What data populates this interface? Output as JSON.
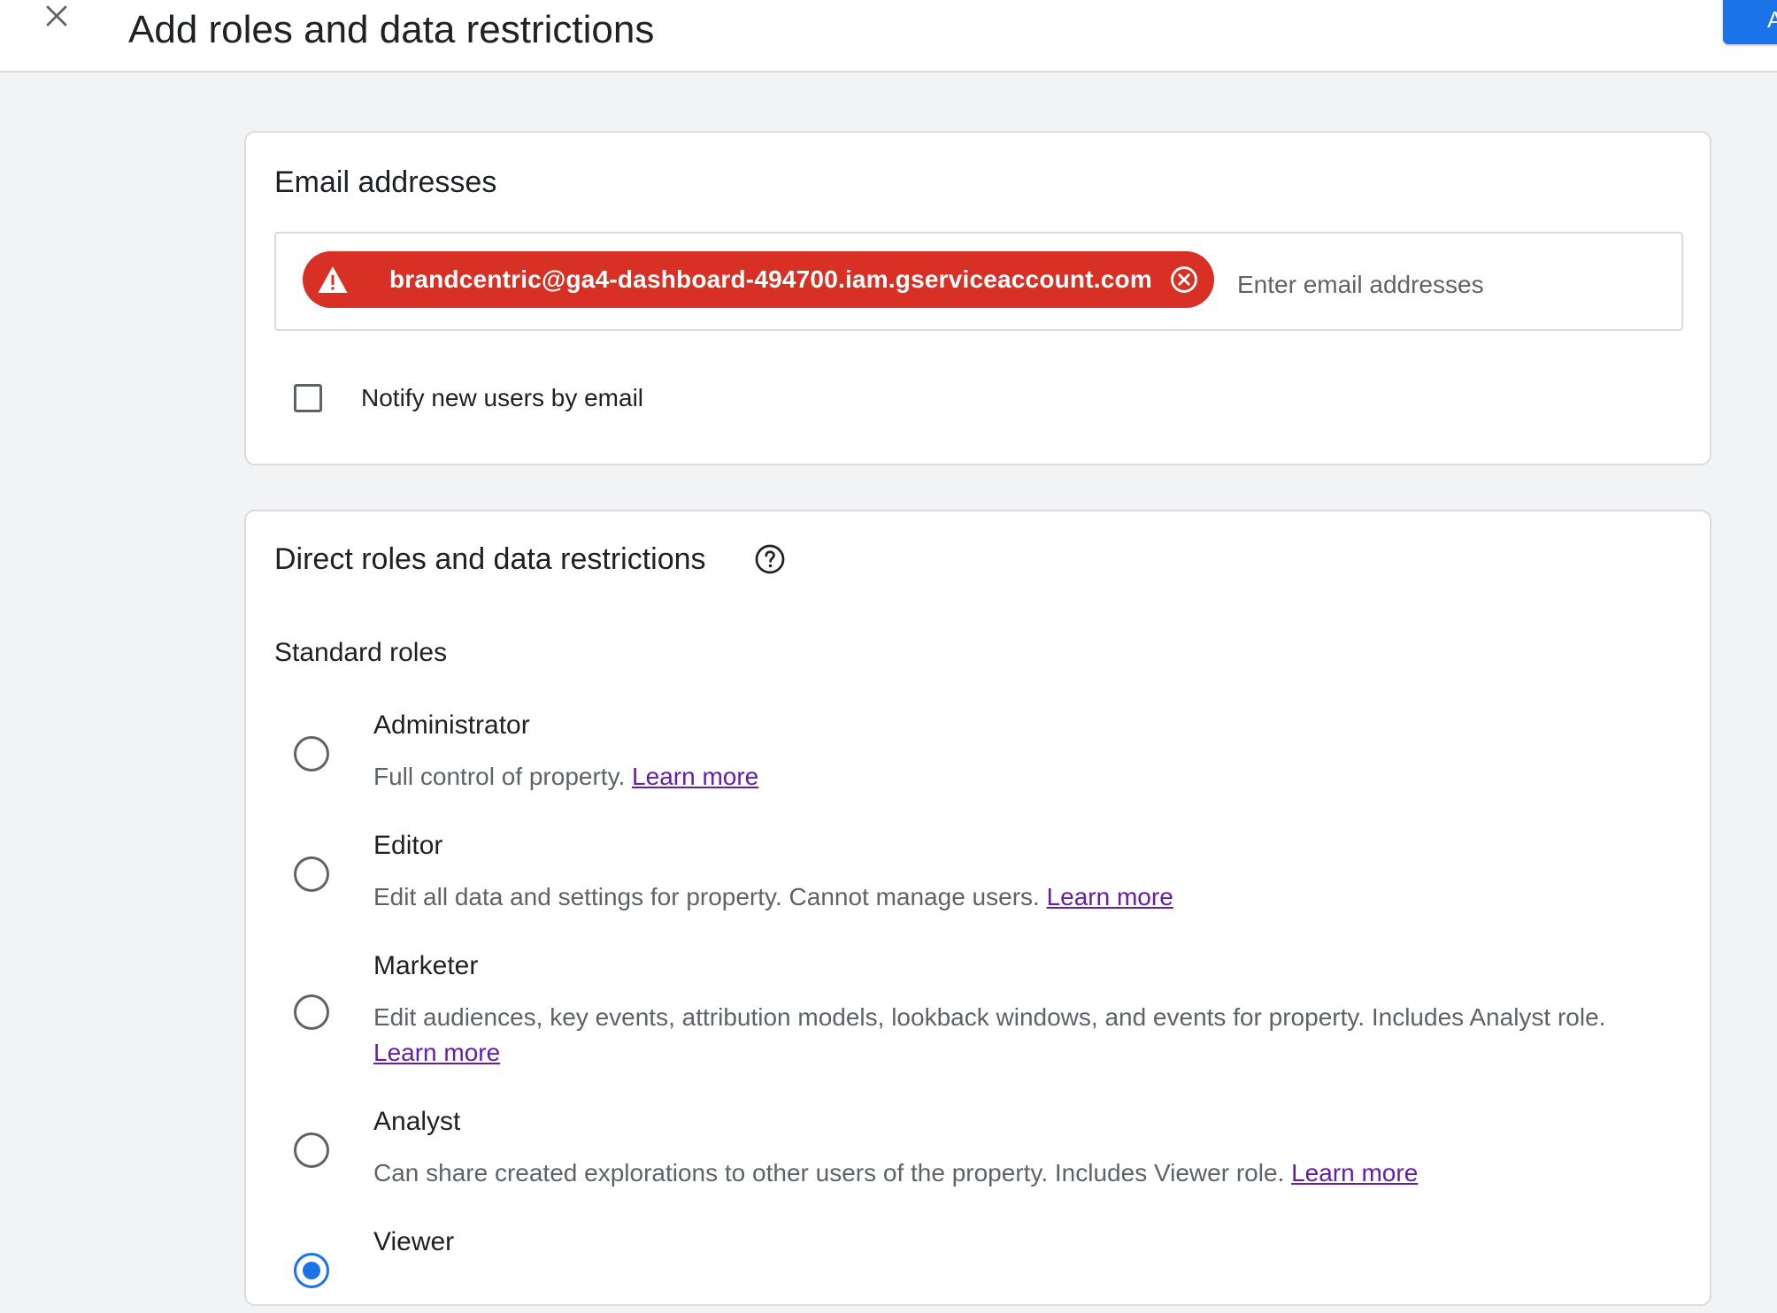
{
  "header": {
    "title": "Add roles and data restrictions",
    "action_label": "A",
    "close_icon": "close-icon"
  },
  "email_card": {
    "title": "Email addresses",
    "chip": {
      "email": "brandcentric@ga4-dashboard-494700.iam.gserviceaccount.com",
      "status": "error",
      "status_icon": "warning-icon",
      "remove_icon": "cancel-circle-icon"
    },
    "input": {
      "value": "",
      "placeholder": "Enter email addresses"
    },
    "notify": {
      "label": "Notify new users by email",
      "checked": false
    }
  },
  "roles_card": {
    "title": "Direct roles and data restrictions",
    "help_icon": "help-circle-icon",
    "subheading": "Standard roles",
    "roles": [
      {
        "name": "Administrator",
        "description": "Full control of property. ",
        "link": "Learn more",
        "selected": false
      },
      {
        "name": "Editor",
        "description": "Edit all data and settings for property. Cannot manage users. ",
        "link": "Learn more",
        "selected": false
      },
      {
        "name": "Marketer",
        "description": "Edit audiences, key events, attribution models, lookback windows, and events for property. Includes Analyst role. ",
        "link": "Learn more",
        "selected": false
      },
      {
        "name": "Analyst",
        "description": "Can share created explorations to other users of the property. Includes Viewer role. ",
        "link": "Learn more",
        "selected": false
      },
      {
        "name": "Viewer",
        "description": "",
        "link": "",
        "selected": true
      }
    ]
  },
  "colors": {
    "primary": "#1a73e8",
    "error": "#d93025",
    "link": "#681da8",
    "background": "#f1f3f4"
  }
}
